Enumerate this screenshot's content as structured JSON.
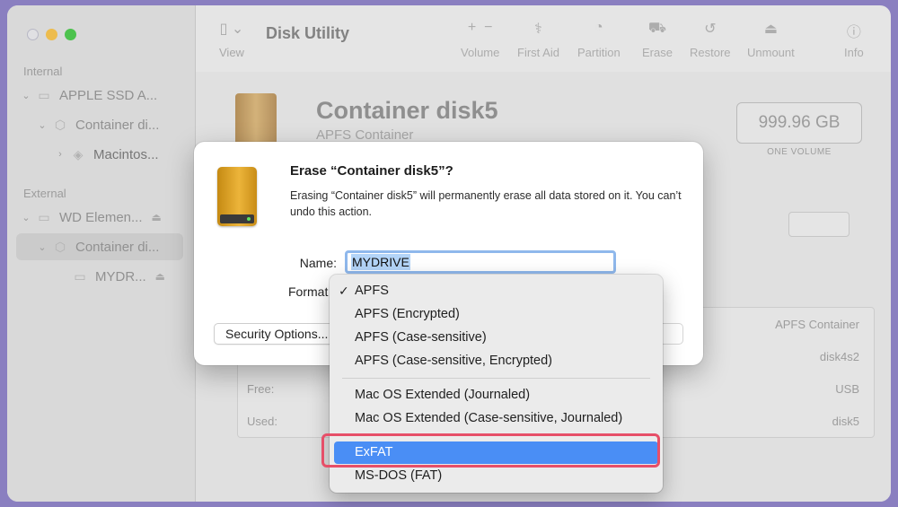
{
  "sidebar": {
    "internal_label": "Internal",
    "external_label": "External",
    "items": [
      {
        "label": "APPLE SSD A...",
        "icon": "drive-icon"
      },
      {
        "label": "Container di...",
        "icon": "container-icon"
      },
      {
        "label": "Macintos...",
        "icon": "volume-stack-icon"
      },
      {
        "label": "WD Elemen...",
        "icon": "drive-icon"
      },
      {
        "label": "Container di...",
        "icon": "container-icon"
      },
      {
        "label": "MYDR...",
        "icon": "drive-icon"
      }
    ]
  },
  "toolbar": {
    "view_label": "View",
    "app_title": "Disk Utility",
    "buttons": [
      {
        "label": "Volume",
        "icon": "plus-minus-icon"
      },
      {
        "label": "First Aid",
        "icon": "stethoscope-icon"
      },
      {
        "label": "Partition",
        "icon": "pie-icon"
      },
      {
        "label": "Erase",
        "icon": "erase-icon"
      },
      {
        "label": "Restore",
        "icon": "restore-icon"
      },
      {
        "label": "Unmount",
        "icon": "eject-icon"
      },
      {
        "label": "Info",
        "icon": "info-icon"
      }
    ]
  },
  "main": {
    "title": "Container disk5",
    "subtitle": "APFS Container",
    "capacity": "999.96 GB",
    "capacity_label": "ONE VOLUME",
    "info": [
      {
        "key": "",
        "value": "APFS Container"
      },
      {
        "key": "",
        "value": "disk4s2"
      },
      {
        "key": "Free:",
        "value": "USB"
      },
      {
        "key": "Used:",
        "value": "disk5"
      }
    ]
  },
  "dialog": {
    "title": "Erase “Container disk5”?",
    "message": "Erasing “Container disk5” will permanently erase all data stored on it. You can’t undo this action.",
    "name_label": "Name:",
    "name_value": "MYDRIVE",
    "format_label": "Format",
    "security_label": "Security Options..."
  },
  "format_menu": {
    "items": [
      {
        "label": "APFS",
        "checked": true
      },
      {
        "label": "APFS (Encrypted)"
      },
      {
        "label": "APFS (Case-sensitive)"
      },
      {
        "label": "APFS (Case-sensitive, Encrypted)"
      },
      {
        "label": "Mac OS Extended (Journaled)"
      },
      {
        "label": "Mac OS Extended (Case-sensitive, Journaled)"
      },
      {
        "label": "ExFAT",
        "highlighted": true
      },
      {
        "label": "MS-DOS (FAT)"
      }
    ],
    "check_mark": "✓",
    "highlight_color": "#4a8ef5",
    "callout_color": "#e64f68"
  }
}
